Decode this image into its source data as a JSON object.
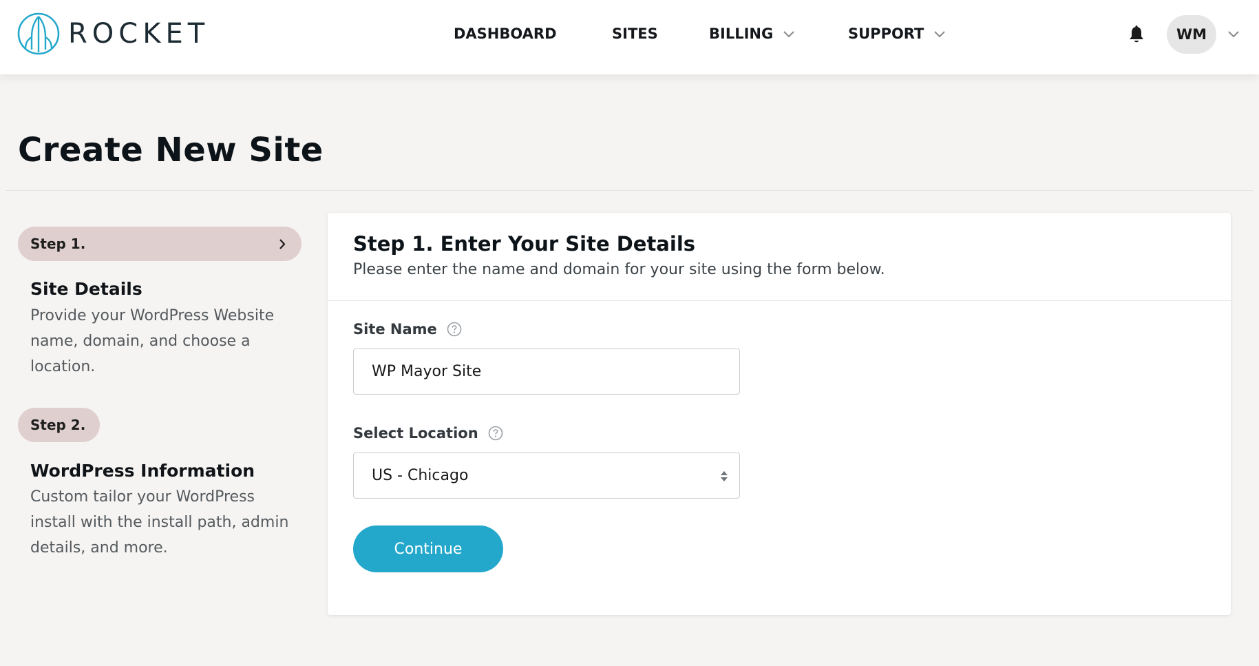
{
  "brand": {
    "name": "ROCKET",
    "accent_color": "#23a8cc",
    "logo_icon": "rocket-logo-icon"
  },
  "nav": {
    "items": [
      {
        "label": "DASHBOARD",
        "has_dropdown": false
      },
      {
        "label": "SITES",
        "has_dropdown": false
      },
      {
        "label": "BILLING",
        "has_dropdown": true
      },
      {
        "label": "SUPPORT",
        "has_dropdown": true
      }
    ],
    "notifications_icon": "bell-icon",
    "user_initials": "WM",
    "user_menu_icon": "chevron-down-icon"
  },
  "page": {
    "title": "Create New Site"
  },
  "steps": [
    {
      "label": "Step 1.",
      "heading": "Site Details",
      "description": "Provide your WordPress Website name, domain, and choose a location.",
      "active": true,
      "pill_color": "#e0cfcf"
    },
    {
      "label": "Step 2.",
      "heading": "WordPress Information",
      "description": "Custom tailor your WordPress install with the install path, admin details, and more.",
      "active": false,
      "pill_color": "#e0cfcf"
    }
  ],
  "form": {
    "title": "Step 1. Enter Your Site Details",
    "subtitle": "Please enter the name and domain for your site using the form below.",
    "site_name": {
      "label": "Site Name",
      "value": "WP Mayor Site",
      "help_icon": "question-circle-icon"
    },
    "location": {
      "label": "Select Location",
      "selected": "US - Chicago",
      "help_icon": "question-circle-icon"
    },
    "continue_label": "Continue"
  }
}
